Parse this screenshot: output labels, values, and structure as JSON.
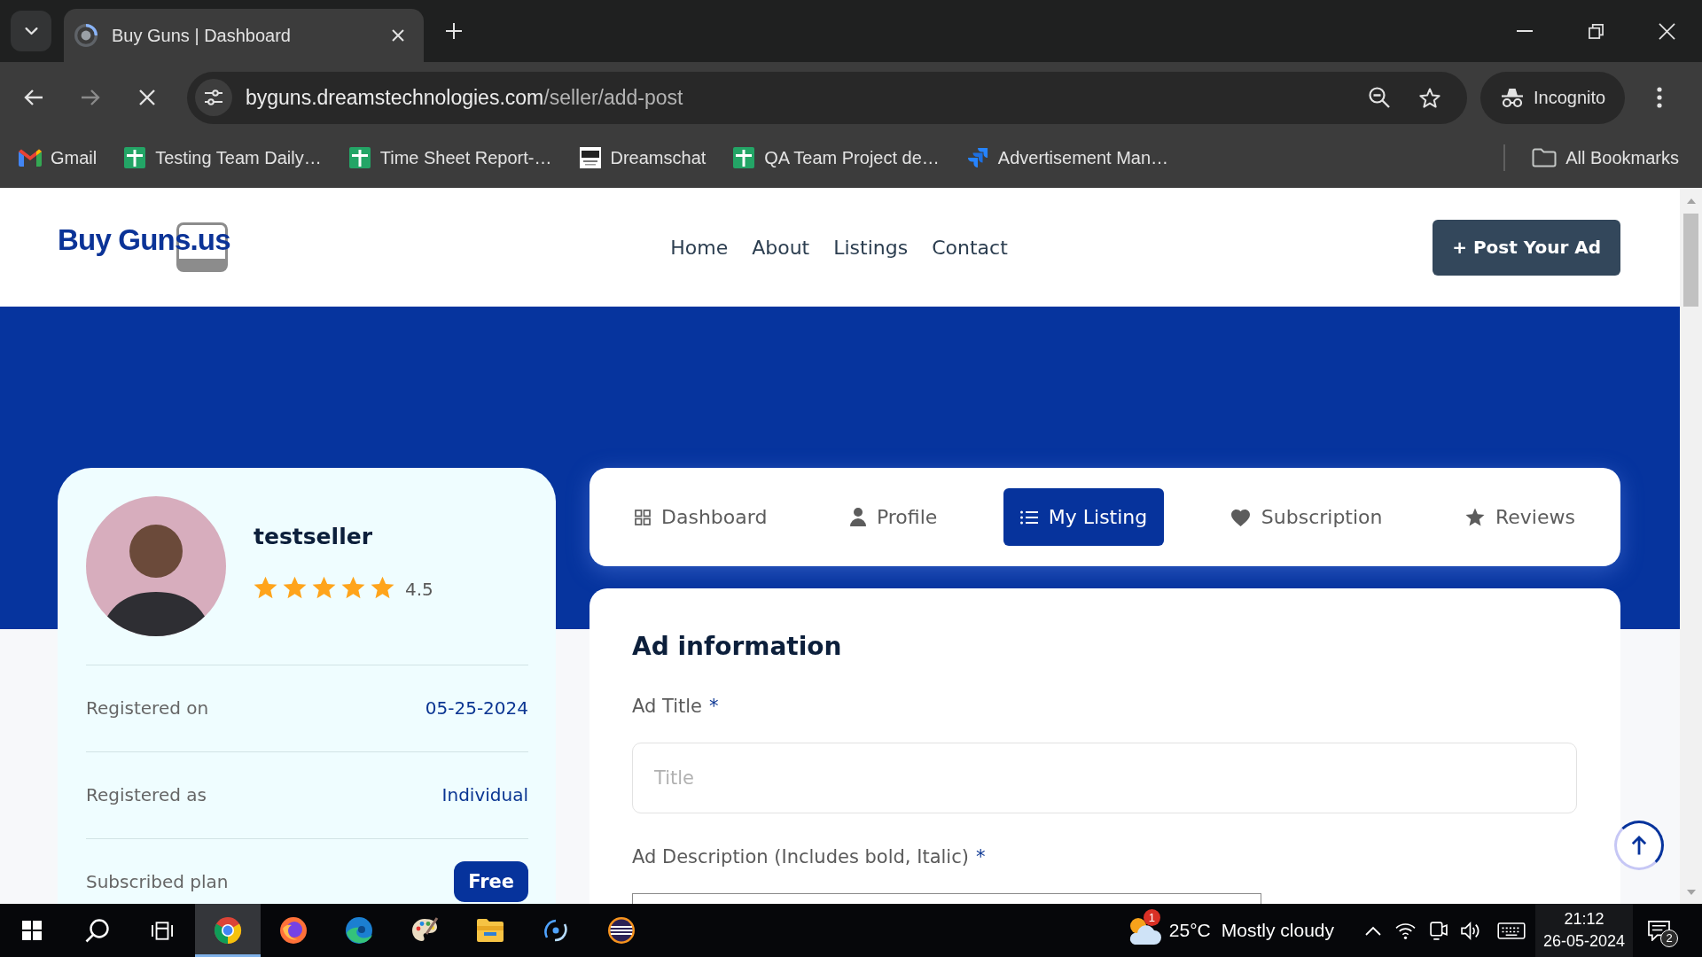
{
  "browser": {
    "tab": {
      "title": "Buy Guns | Dashboard"
    },
    "address": {
      "host": "byguns.dreamstechnologies.com",
      "path": "/seller/add-post"
    },
    "profile_chip": "Incognito",
    "bookmarks": [
      {
        "kind": "mail",
        "label": "Gmail"
      },
      {
        "kind": "sheet",
        "label": "Testing Team Daily…"
      },
      {
        "kind": "sheet",
        "label": "Time Sheet Report-…"
      },
      {
        "kind": "logo",
        "label": "Dreamschat"
      },
      {
        "kind": "sheet",
        "label": "QA Team Project de…"
      },
      {
        "kind": "board",
        "label": "Advertisement Man…"
      }
    ],
    "all_bookmarks": "All Bookmarks"
  },
  "site_header": {
    "logo": "Buy Guns.us",
    "nav": [
      "Home",
      "About",
      "Listings",
      "Contact"
    ],
    "post_button": "+ Post Your Ad"
  },
  "profile_card": {
    "name": "testseller",
    "stars": 5,
    "rating": "4.5",
    "details": [
      {
        "kind": "text",
        "label": "Registered on",
        "value": "05-25-2024"
      },
      {
        "kind": "text",
        "label": "Registered as",
        "value": "Individual"
      },
      {
        "kind": "badge",
        "label": "Subscribed plan",
        "value": "Free"
      }
    ]
  },
  "dashboard_tabs": [
    {
      "label": "Dashboard",
      "selected": false
    },
    {
      "label": "Profile",
      "selected": false
    },
    {
      "label": "My Listing",
      "selected": true
    },
    {
      "label": "Subscription",
      "selected": false
    },
    {
      "label": "Reviews",
      "selected": false
    }
  ],
  "ad_form": {
    "title": "Ad information",
    "fields": [
      {
        "kind": "input",
        "label": "Ad Title",
        "required_mark": "*",
        "placeholder": "Title"
      },
      {
        "kind": "editor",
        "label": "Ad Description (Includes bold, Italic)",
        "required_mark": "*"
      }
    ]
  },
  "taskbar": {
    "apps": [
      {
        "kind": "chrome",
        "selected": true
      },
      {
        "kind": "firefox",
        "selected": false
      },
      {
        "kind": "edge",
        "selected": false
      },
      {
        "kind": "paint",
        "selected": false
      },
      {
        "kind": "files",
        "selected": false
      },
      {
        "kind": "swirl",
        "selected": false
      },
      {
        "kind": "eclipse",
        "selected": false
      }
    ],
    "weather": {
      "badge": "1",
      "temperature": "25°C",
      "condition": "Mostly cloudy"
    },
    "clock": {
      "time": "21:12",
      "date": "26-05-2024"
    },
    "notifications": "2"
  }
}
